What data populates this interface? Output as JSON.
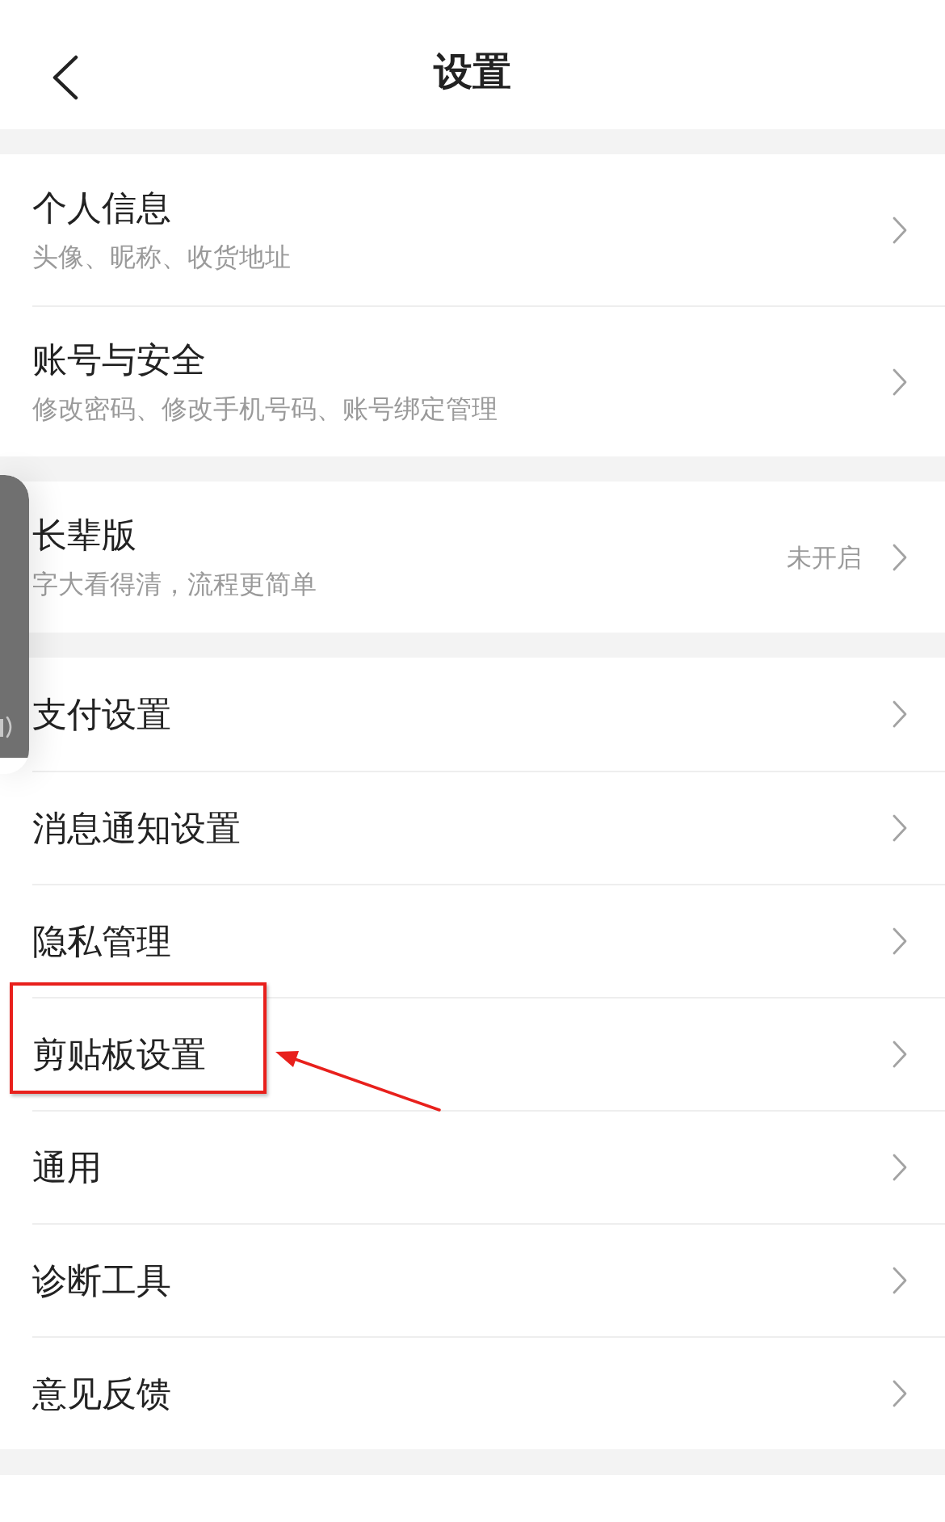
{
  "header": {
    "title": "设置"
  },
  "sections": [
    {
      "items": [
        {
          "title": "个人信息",
          "subtitle": "头像、昵称、收货地址",
          "highlighted": false
        },
        {
          "title": "账号与安全",
          "subtitle": "修改密码、修改手机号码、账号绑定管理",
          "highlighted": false
        }
      ]
    },
    {
      "items": [
        {
          "title": "长辈版",
          "subtitle": "字大看得清，流程更简单",
          "value": "未开启",
          "highlighted": false
        }
      ]
    },
    {
      "items": [
        {
          "title": "支付设置",
          "highlighted": false
        },
        {
          "title": "消息通知设置",
          "highlighted": false
        },
        {
          "title": "隐私管理",
          "highlighted": false
        },
        {
          "title": "剪贴板设置",
          "highlighted": true
        },
        {
          "title": "通用",
          "highlighted": false
        },
        {
          "title": "诊断工具",
          "highlighted": false
        },
        {
          "title": "意见反馈",
          "highlighted": false
        }
      ]
    }
  ]
}
